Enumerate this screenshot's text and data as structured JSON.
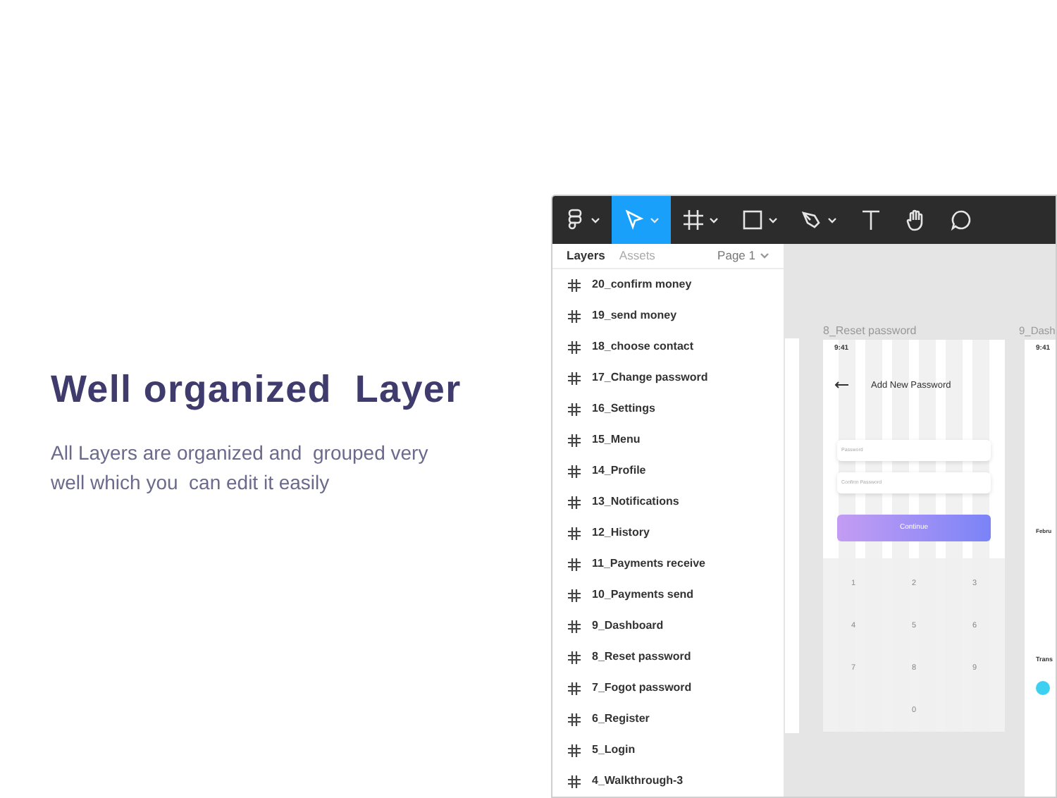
{
  "hero": {
    "title": "Well organized  Layer",
    "text": "All Layers are organized and  grouped very well which you  can edit it easily"
  },
  "toolbar": {
    "tools": [
      {
        "kind": "logo",
        "selected": false
      },
      {
        "kind": "move",
        "selected": true
      },
      {
        "kind": "frame",
        "selected": false
      },
      {
        "kind": "rectangle",
        "selected": false
      },
      {
        "kind": "pen",
        "selected": false
      },
      {
        "kind": "text",
        "selected": false
      },
      {
        "kind": "hand",
        "selected": false
      },
      {
        "kind": "comment",
        "selected": false
      }
    ]
  },
  "sidebar": {
    "tabs": [
      {
        "label": "Layers",
        "selected": true
      },
      {
        "label": "Assets",
        "selected": false
      }
    ],
    "page": "Page 1",
    "layers": [
      "20_confirm money",
      "19_send money",
      "18_choose contact",
      "17_Change password",
      "16_Settings",
      "15_Menu",
      "14_Profile",
      "13_Notifications",
      "12_History",
      "11_Payments receive",
      "10_Payments send",
      "9_Dashboard",
      "8_Reset password",
      "7_Fogot password",
      "6_Register",
      "5_Login",
      "4_Walkthrough-3"
    ]
  },
  "canvas": {
    "frames": [
      {
        "label": "8_Reset password",
        "time": "9:41",
        "title": "Add New Password",
        "fields": [
          "Password",
          "Confirm Password"
        ],
        "button": "Continue",
        "keys": [
          "1",
          "2",
          "3",
          "4",
          "5",
          "6",
          "7",
          "8",
          "9",
          "0"
        ]
      },
      {
        "label": "9_Dash",
        "time": "9:41",
        "texts": [
          "Febru",
          "Trans"
        ]
      }
    ]
  }
}
